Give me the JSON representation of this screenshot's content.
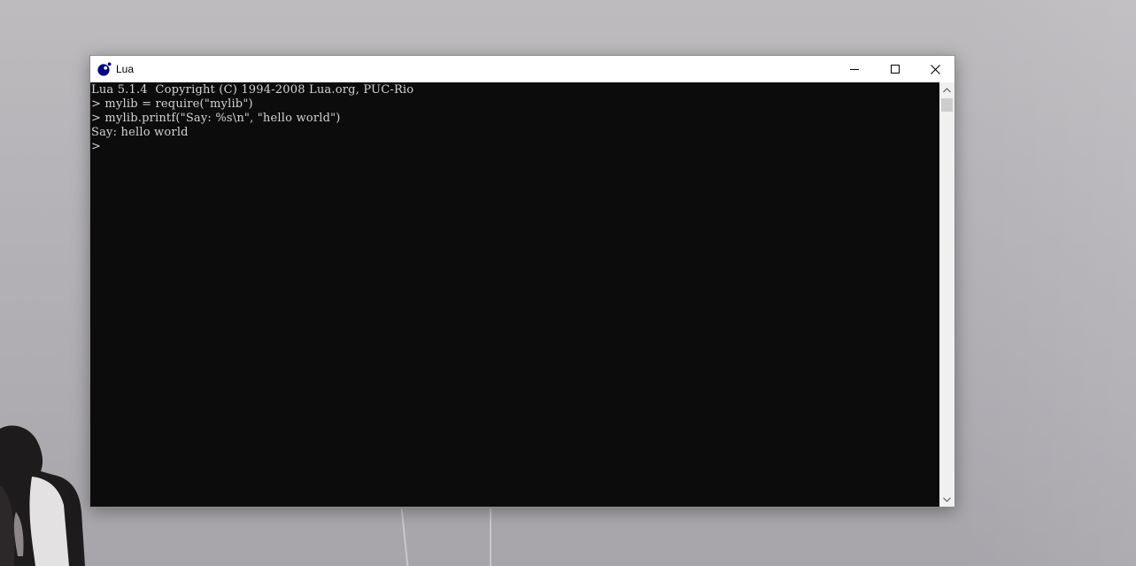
{
  "window": {
    "title": "Lua",
    "controls": {
      "minimize": "minimize-icon",
      "maximize": "maximize-icon",
      "close": "close-icon"
    }
  },
  "console": {
    "lines": [
      "Lua 5.1.4  Copyright (C) 1994-2008 Lua.org, PUC-Rio",
      "> mylib = require(\"mylib\")",
      "> mylib.printf(\"Say: %s\\n\", \"hello world\")",
      "Say: hello world",
      ">"
    ]
  },
  "colors": {
    "console_background": "#0c0c0c",
    "console_text": "#d4d4d4",
    "titlebar": "#ffffff",
    "lua_icon": "#000080"
  }
}
